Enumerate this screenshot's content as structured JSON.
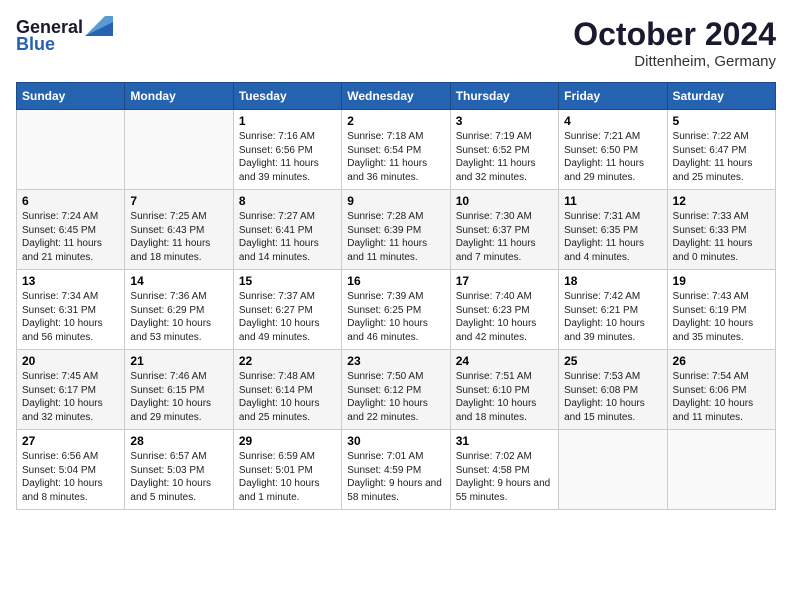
{
  "logo": {
    "general": "General",
    "blue": "Blue"
  },
  "header": {
    "month": "October 2024",
    "location": "Dittenheim, Germany"
  },
  "weekdays": [
    "Sunday",
    "Monday",
    "Tuesday",
    "Wednesday",
    "Thursday",
    "Friday",
    "Saturday"
  ],
  "weeks": [
    [
      {
        "day": "",
        "info": ""
      },
      {
        "day": "",
        "info": ""
      },
      {
        "day": "1",
        "info": "Sunrise: 7:16 AM\nSunset: 6:56 PM\nDaylight: 11 hours and 39 minutes."
      },
      {
        "day": "2",
        "info": "Sunrise: 7:18 AM\nSunset: 6:54 PM\nDaylight: 11 hours and 36 minutes."
      },
      {
        "day": "3",
        "info": "Sunrise: 7:19 AM\nSunset: 6:52 PM\nDaylight: 11 hours and 32 minutes."
      },
      {
        "day": "4",
        "info": "Sunrise: 7:21 AM\nSunset: 6:50 PM\nDaylight: 11 hours and 29 minutes."
      },
      {
        "day": "5",
        "info": "Sunrise: 7:22 AM\nSunset: 6:47 PM\nDaylight: 11 hours and 25 minutes."
      }
    ],
    [
      {
        "day": "6",
        "info": "Sunrise: 7:24 AM\nSunset: 6:45 PM\nDaylight: 11 hours and 21 minutes."
      },
      {
        "day": "7",
        "info": "Sunrise: 7:25 AM\nSunset: 6:43 PM\nDaylight: 11 hours and 18 minutes."
      },
      {
        "day": "8",
        "info": "Sunrise: 7:27 AM\nSunset: 6:41 PM\nDaylight: 11 hours and 14 minutes."
      },
      {
        "day": "9",
        "info": "Sunrise: 7:28 AM\nSunset: 6:39 PM\nDaylight: 11 hours and 11 minutes."
      },
      {
        "day": "10",
        "info": "Sunrise: 7:30 AM\nSunset: 6:37 PM\nDaylight: 11 hours and 7 minutes."
      },
      {
        "day": "11",
        "info": "Sunrise: 7:31 AM\nSunset: 6:35 PM\nDaylight: 11 hours and 4 minutes."
      },
      {
        "day": "12",
        "info": "Sunrise: 7:33 AM\nSunset: 6:33 PM\nDaylight: 11 hours and 0 minutes."
      }
    ],
    [
      {
        "day": "13",
        "info": "Sunrise: 7:34 AM\nSunset: 6:31 PM\nDaylight: 10 hours and 56 minutes."
      },
      {
        "day": "14",
        "info": "Sunrise: 7:36 AM\nSunset: 6:29 PM\nDaylight: 10 hours and 53 minutes."
      },
      {
        "day": "15",
        "info": "Sunrise: 7:37 AM\nSunset: 6:27 PM\nDaylight: 10 hours and 49 minutes."
      },
      {
        "day": "16",
        "info": "Sunrise: 7:39 AM\nSunset: 6:25 PM\nDaylight: 10 hours and 46 minutes."
      },
      {
        "day": "17",
        "info": "Sunrise: 7:40 AM\nSunset: 6:23 PM\nDaylight: 10 hours and 42 minutes."
      },
      {
        "day": "18",
        "info": "Sunrise: 7:42 AM\nSunset: 6:21 PM\nDaylight: 10 hours and 39 minutes."
      },
      {
        "day": "19",
        "info": "Sunrise: 7:43 AM\nSunset: 6:19 PM\nDaylight: 10 hours and 35 minutes."
      }
    ],
    [
      {
        "day": "20",
        "info": "Sunrise: 7:45 AM\nSunset: 6:17 PM\nDaylight: 10 hours and 32 minutes."
      },
      {
        "day": "21",
        "info": "Sunrise: 7:46 AM\nSunset: 6:15 PM\nDaylight: 10 hours and 29 minutes."
      },
      {
        "day": "22",
        "info": "Sunrise: 7:48 AM\nSunset: 6:14 PM\nDaylight: 10 hours and 25 minutes."
      },
      {
        "day": "23",
        "info": "Sunrise: 7:50 AM\nSunset: 6:12 PM\nDaylight: 10 hours and 22 minutes."
      },
      {
        "day": "24",
        "info": "Sunrise: 7:51 AM\nSunset: 6:10 PM\nDaylight: 10 hours and 18 minutes."
      },
      {
        "day": "25",
        "info": "Sunrise: 7:53 AM\nSunset: 6:08 PM\nDaylight: 10 hours and 15 minutes."
      },
      {
        "day": "26",
        "info": "Sunrise: 7:54 AM\nSunset: 6:06 PM\nDaylight: 10 hours and 11 minutes."
      }
    ],
    [
      {
        "day": "27",
        "info": "Sunrise: 6:56 AM\nSunset: 5:04 PM\nDaylight: 10 hours and 8 minutes."
      },
      {
        "day": "28",
        "info": "Sunrise: 6:57 AM\nSunset: 5:03 PM\nDaylight: 10 hours and 5 minutes."
      },
      {
        "day": "29",
        "info": "Sunrise: 6:59 AM\nSunset: 5:01 PM\nDaylight: 10 hours and 1 minute."
      },
      {
        "day": "30",
        "info": "Sunrise: 7:01 AM\nSunset: 4:59 PM\nDaylight: 9 hours and 58 minutes."
      },
      {
        "day": "31",
        "info": "Sunrise: 7:02 AM\nSunset: 4:58 PM\nDaylight: 9 hours and 55 minutes."
      },
      {
        "day": "",
        "info": ""
      },
      {
        "day": "",
        "info": ""
      }
    ]
  ]
}
